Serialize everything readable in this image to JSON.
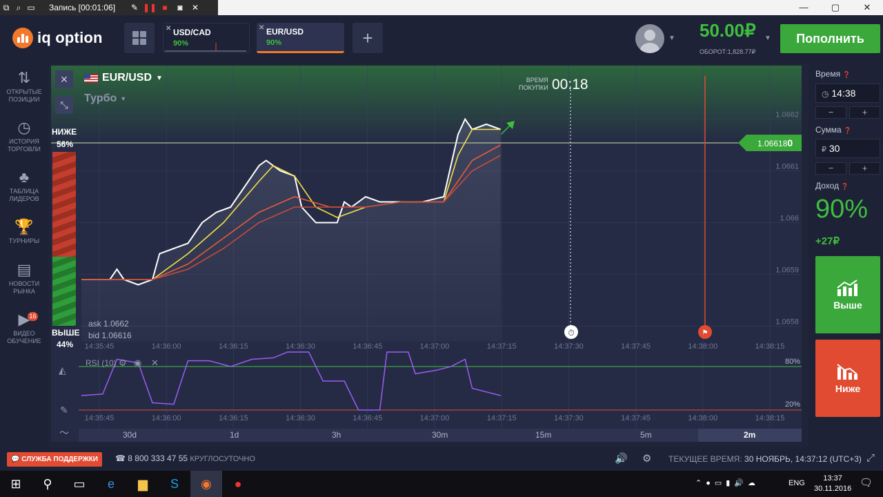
{
  "recorder": {
    "title": "Запись [00:01:06]"
  },
  "window": {
    "minimize": "—",
    "maximize": "▢",
    "close": "✕"
  },
  "header": {
    "logo": "iq option",
    "tabs": [
      {
        "symbol": "USD/CAD",
        "payout": "90%"
      },
      {
        "symbol": "EUR/USD",
        "payout": "90%"
      }
    ],
    "add_tab": "+",
    "balance": "50.00₽",
    "turnover": "ОБОРОТ:1,828.77₽",
    "deposit_label": "Пополнить"
  },
  "sidebar": {
    "items": [
      {
        "label1": "ОТКРЫТЫЕ",
        "label2": "ПОЗИЦИИ",
        "icon": "⇅"
      },
      {
        "label1": "ИСТОРИЯ",
        "label2": "ТОРГОВЛИ",
        "icon": "◷"
      },
      {
        "label1": "ТАБЛИЦА",
        "label2": "ЛИДЕРОВ",
        "icon": "♣"
      },
      {
        "label1": "ТУРНИРЫ",
        "label2": "",
        "icon": "🏆"
      },
      {
        "label1": "НОВОСТИ",
        "label2": "РЫНКА",
        "icon": "▤"
      },
      {
        "label1": "ВИДЕО",
        "label2": "ОБУЧЕНИЕ",
        "icon": "▶",
        "badge": "16"
      }
    ]
  },
  "chart": {
    "pair": "EUR/USD",
    "mode": "Турбо",
    "purchase_time_label1": "ВРЕМЯ",
    "purchase_time_label2": "ПОКУПКИ",
    "purchase_countdown": "00:18",
    "lower_label": "НИЖЕ",
    "lower_pct": "56%",
    "higher_label": "ВЫШЕ",
    "higher_pct": "44%",
    "ask": "ask 1.0662",
    "bid": "bid 1.06616",
    "current_price_main": "1.06618",
    "current_price_bold": "0",
    "rsi_label": "RSI (10)",
    "rsi_upper": "80%",
    "rsi_lower": "20%"
  },
  "chart_data": {
    "type": "line",
    "x_ticks": [
      "14:35:45",
      "14:36:00",
      "14:36:15",
      "14:36:30",
      "14:36:45",
      "14:37:00",
      "14:37:15",
      "14:37:30",
      "14:37:45",
      "14:38:00",
      "14:38:15"
    ],
    "y_ticks": [
      "1.0662",
      "1.0661",
      "1.066",
      "1.0659",
      "1.0658"
    ],
    "ylim": [
      1.06577,
      1.06625
    ],
    "series": [
      {
        "color": "#ffffff",
        "values": [
          [
            0,
            1.06589
          ],
          [
            4,
            1.06589
          ],
          [
            5,
            1.06591
          ],
          [
            6,
            1.06589
          ],
          [
            8,
            1.06588
          ],
          [
            10,
            1.06589
          ],
          [
            11,
            1.06594
          ],
          [
            13,
            1.06595
          ],
          [
            15,
            1.06596
          ],
          [
            17,
            1.066
          ],
          [
            19,
            1.06602
          ],
          [
            21,
            1.06603
          ],
          [
            23,
            1.06607
          ],
          [
            25,
            1.06611
          ],
          [
            26,
            1.06612
          ],
          [
            28,
            1.0661
          ],
          [
            30,
            1.06609
          ],
          [
            31,
            1.06603
          ],
          [
            33,
            1.066
          ],
          [
            35,
            1.066
          ],
          [
            36,
            1.066
          ],
          [
            37,
            1.06604
          ],
          [
            38,
            1.06603
          ],
          [
            40,
            1.06605
          ],
          [
            42,
            1.06604
          ],
          [
            44,
            1.06604
          ],
          [
            46,
            1.06604
          ],
          [
            48,
            1.06604
          ],
          [
            51,
            1.06605
          ],
          [
            53,
            1.06617
          ],
          [
            54,
            1.0662
          ],
          [
            55,
            1.06618
          ],
          [
            57,
            1.06619
          ],
          [
            59,
            1.06618
          ]
        ]
      },
      {
        "color": "#f3e04a",
        "values": [
          [
            0,
            1.06589
          ],
          [
            5,
            1.06589
          ],
          [
            10,
            1.06589
          ],
          [
            15,
            1.06594
          ],
          [
            20,
            1.066
          ],
          [
            25,
            1.06608
          ],
          [
            27,
            1.06611
          ],
          [
            30,
            1.06609
          ],
          [
            33,
            1.06603
          ],
          [
            36,
            1.06601
          ],
          [
            40,
            1.06603
          ],
          [
            45,
            1.06604
          ],
          [
            51,
            1.06604
          ],
          [
            53,
            1.06613
          ],
          [
            55,
            1.06618
          ],
          [
            59,
            1.06618
          ]
        ]
      },
      {
        "color": "#e85a3a",
        "values": [
          [
            0,
            1.06589
          ],
          [
            10,
            1.06589
          ],
          [
            15,
            1.06592
          ],
          [
            20,
            1.06597
          ],
          [
            25,
            1.06602
          ],
          [
            30,
            1.06605
          ],
          [
            35,
            1.06603
          ],
          [
            40,
            1.06603
          ],
          [
            45,
            1.06604
          ],
          [
            51,
            1.06604
          ],
          [
            55,
            1.06612
          ],
          [
            59,
            1.06615
          ]
        ]
      },
      {
        "color": "#c84a3a",
        "values": [
          [
            0,
            1.06589
          ],
          [
            10,
            1.06589
          ],
          [
            15,
            1.06591
          ],
          [
            20,
            1.06595
          ],
          [
            25,
            1.066
          ],
          [
            30,
            1.06603
          ],
          [
            35,
            1.06603
          ],
          [
            40,
            1.06603
          ],
          [
            45,
            1.06604
          ],
          [
            51,
            1.06604
          ],
          [
            55,
            1.0661
          ],
          [
            59,
            1.06613
          ]
        ]
      }
    ],
    "rsi": [
      [
        0,
        40
      ],
      [
        3,
        42
      ],
      [
        5,
        90
      ],
      [
        8,
        85
      ],
      [
        10,
        30
      ],
      [
        13,
        28
      ],
      [
        15,
        88
      ],
      [
        18,
        88
      ],
      [
        21,
        80
      ],
      [
        24,
        90
      ],
      [
        27,
        92
      ],
      [
        29,
        100
      ],
      [
        32,
        100
      ],
      [
        34,
        60
      ],
      [
        37,
        60
      ],
      [
        39,
        20
      ],
      [
        42,
        20
      ],
      [
        43,
        100
      ],
      [
        46,
        100
      ],
      [
        47,
        70
      ],
      [
        50,
        75
      ],
      [
        52,
        80
      ],
      [
        54,
        90
      ],
      [
        55,
        50
      ],
      [
        57,
        45
      ],
      [
        59,
        40
      ]
    ]
  },
  "timeframes": [
    "30d",
    "1d",
    "3h",
    "30m",
    "15m",
    "5m",
    "2m"
  ],
  "right_panel": {
    "time_label": "Время",
    "time_value": "14:38",
    "amount_label": "Сумма",
    "amount_currency": "₽",
    "amount_value": "30",
    "minus": "−",
    "plus": "+",
    "income_label": "Доход",
    "income_pct": "90%",
    "income_value": "+27₽",
    "call_label": "Выше",
    "put_label": "Ниже"
  },
  "footer": {
    "support": "СЛУЖБА ПОДДЕРЖКИ",
    "phone": "8 800 333 47 55",
    "hours": "КРУГЛОСУТОЧНО",
    "current_time_label": "ТЕКУЩЕЕ ВРЕМЯ:",
    "current_time_value": "30 НОЯБРЬ, 14:37:12 (UTC+3)"
  },
  "taskbar": {
    "lang": "ENG",
    "time": "13:37",
    "date": "30.11.2016"
  }
}
